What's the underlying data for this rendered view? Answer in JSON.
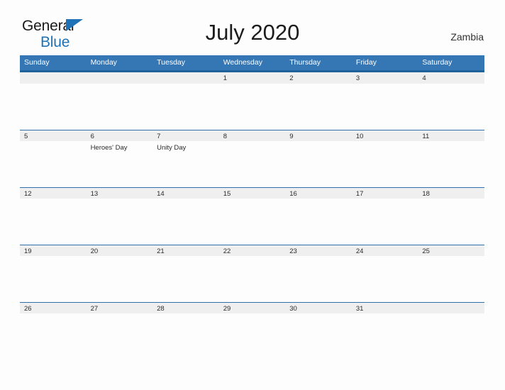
{
  "brand": {
    "line1": "General",
    "line2": "Blue",
    "accent_color": "#1f72b5"
  },
  "header": {
    "title": "July 2020",
    "country": "Zambia"
  },
  "theme": {
    "header_blue": "#3576b5",
    "header_rule": "#1f6199",
    "band_gray": "#efefef",
    "page_background": "#fdfdfd"
  },
  "calendar": {
    "weekday_headers": [
      "Sunday",
      "Monday",
      "Tuesday",
      "Wednesday",
      "Thursday",
      "Friday",
      "Saturday"
    ],
    "weeks": [
      [
        {
          "day": ""
        },
        {
          "day": ""
        },
        {
          "day": ""
        },
        {
          "day": "1",
          "events": []
        },
        {
          "day": "2",
          "events": []
        },
        {
          "day": "3",
          "events": []
        },
        {
          "day": "4",
          "events": []
        }
      ],
      [
        {
          "day": "5",
          "events": []
        },
        {
          "day": "6",
          "events": [
            "Heroes' Day"
          ]
        },
        {
          "day": "7",
          "events": [
            "Unity Day"
          ]
        },
        {
          "day": "8",
          "events": []
        },
        {
          "day": "9",
          "events": []
        },
        {
          "day": "10",
          "events": []
        },
        {
          "day": "11",
          "events": []
        }
      ],
      [
        {
          "day": "12",
          "events": []
        },
        {
          "day": "13",
          "events": []
        },
        {
          "day": "14",
          "events": []
        },
        {
          "day": "15",
          "events": []
        },
        {
          "day": "16",
          "events": []
        },
        {
          "day": "17",
          "events": []
        },
        {
          "day": "18",
          "events": []
        }
      ],
      [
        {
          "day": "19",
          "events": []
        },
        {
          "day": "20",
          "events": []
        },
        {
          "day": "21",
          "events": []
        },
        {
          "day": "22",
          "events": []
        },
        {
          "day": "23",
          "events": []
        },
        {
          "day": "24",
          "events": []
        },
        {
          "day": "25",
          "events": []
        }
      ],
      [
        {
          "day": "26",
          "events": []
        },
        {
          "day": "27",
          "events": []
        },
        {
          "day": "28",
          "events": []
        },
        {
          "day": "29",
          "events": []
        },
        {
          "day": "30",
          "events": []
        },
        {
          "day": "31",
          "events": []
        },
        {
          "day": ""
        }
      ]
    ]
  }
}
